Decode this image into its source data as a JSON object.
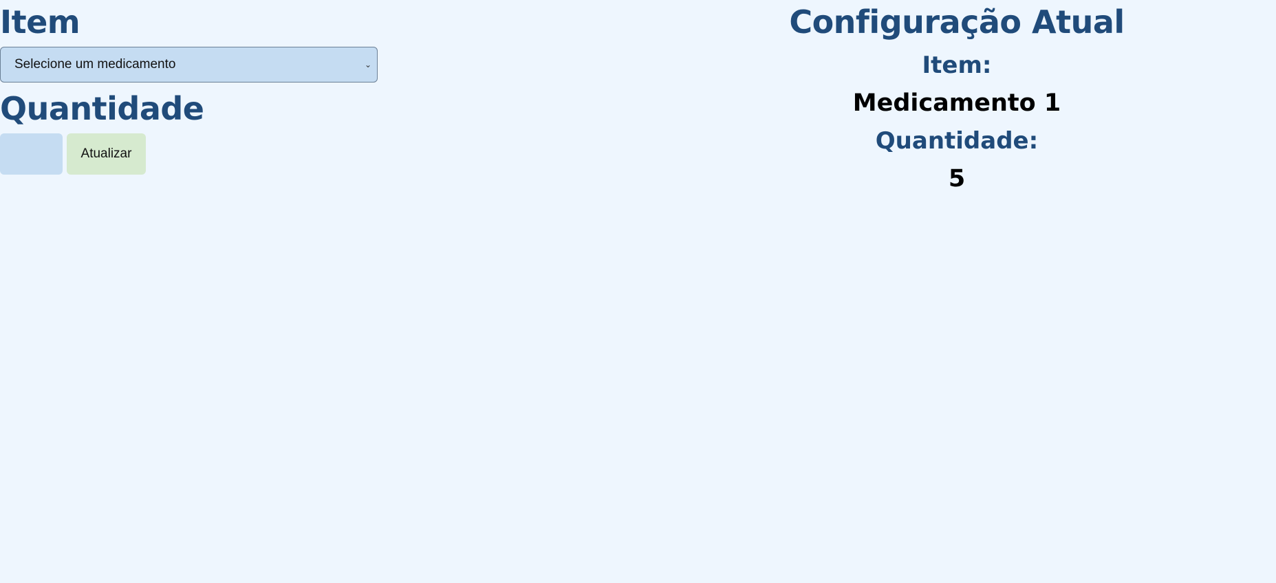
{
  "form": {
    "item_heading": "Item",
    "select_value": "Selecione um medicamento",
    "quantity_heading": "Quantidade",
    "quantity_value": "",
    "update_button_label": "Atualizar"
  },
  "current_config": {
    "title": "Configuração Atual",
    "item_label": "Item:",
    "item_value": "Medicamento 1",
    "quantity_label": "Quantidade:",
    "quantity_value": "5"
  },
  "colors": {
    "background": "#eef6fe",
    "heading": "#204b7a",
    "input_bg": "#c5dcf2",
    "button_bg": "#d6eacf"
  },
  "icons": {
    "select_chevron": "chevron-down-icon"
  }
}
